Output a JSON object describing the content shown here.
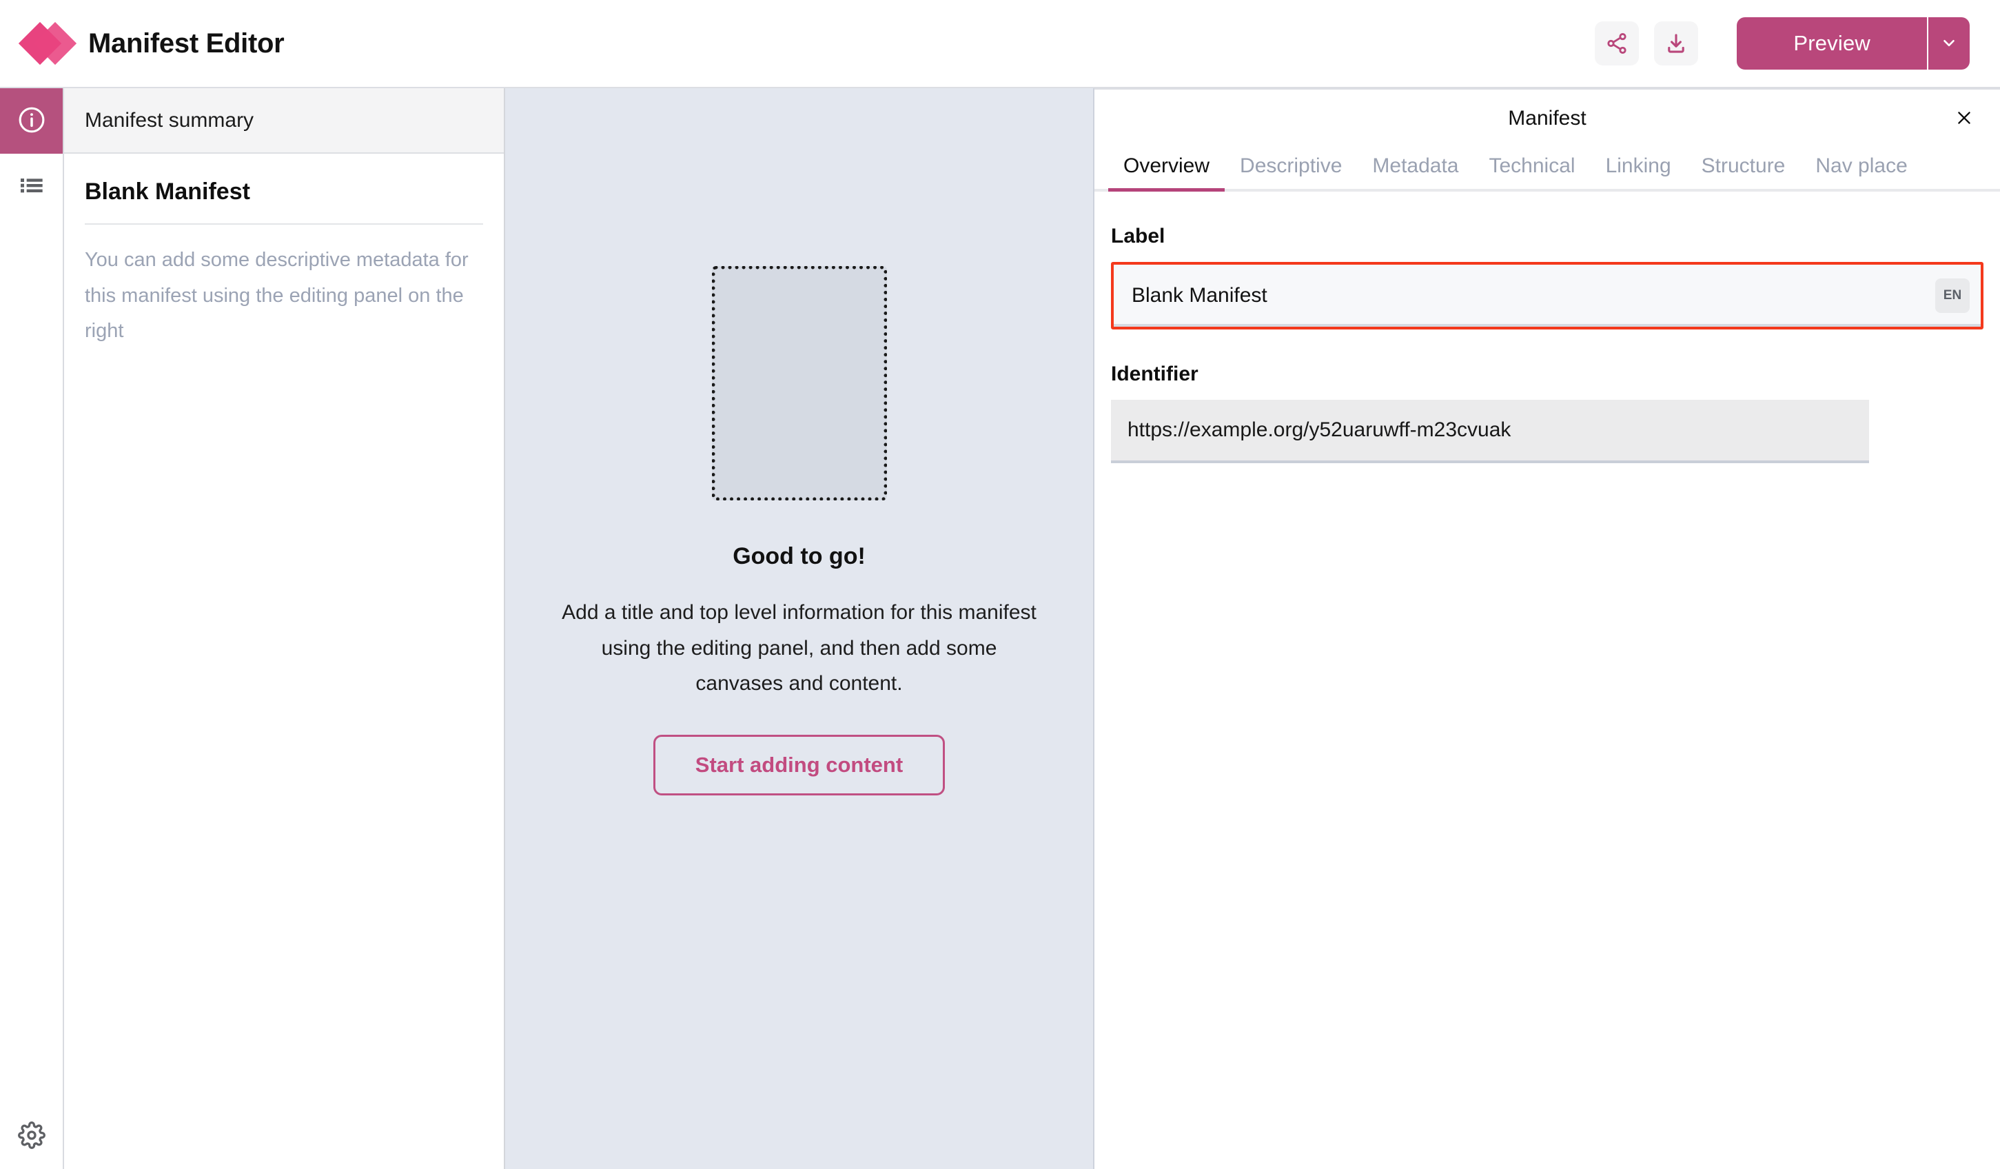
{
  "app": {
    "title": "Manifest Editor",
    "logo_icon": "diamonds-logo-icon",
    "accent_color": "#b9477b",
    "brand_pink": "#e8437f"
  },
  "toolbar": {
    "share_icon": "share-icon",
    "download_icon": "download-icon",
    "preview_label": "Preview",
    "preview_caret_icon": "chevron-down-icon"
  },
  "rail": {
    "items": [
      {
        "icon": "info-circle-icon",
        "name": "manifest-summary",
        "active": true
      },
      {
        "icon": "list-icon",
        "name": "canvas-list",
        "active": false
      }
    ],
    "settings_icon": "gear-icon"
  },
  "summary": {
    "header": "Manifest summary",
    "title": "Blank Manifest",
    "description": "You can add some descriptive metadata for this manifest using the editing panel on the right"
  },
  "canvas": {
    "placeholder_icon": "empty-canvas-placeholder",
    "heading": "Good to go!",
    "body": "Add a title and top level information for this manifest using the editing panel, and then add some canvases and content.",
    "cta_label": "Start adding content"
  },
  "editor": {
    "title": "Manifest",
    "close_icon": "close-icon",
    "tabs": [
      {
        "label": "Overview",
        "active": true
      },
      {
        "label": "Descriptive",
        "active": false
      },
      {
        "label": "Metadata",
        "active": false
      },
      {
        "label": "Technical",
        "active": false
      },
      {
        "label": "Linking",
        "active": false
      },
      {
        "label": "Structure",
        "active": false
      },
      {
        "label": "Nav place",
        "active": false
      }
    ],
    "fields": {
      "label": {
        "label": "Label",
        "value": "Blank Manifest",
        "placeholder": "",
        "lang_badge": "EN",
        "highlight_color": "#f4391c"
      },
      "identifier": {
        "label": "Identifier",
        "value": "https://example.org/y52uaruwff-m23cvuak",
        "placeholder": ""
      }
    }
  }
}
